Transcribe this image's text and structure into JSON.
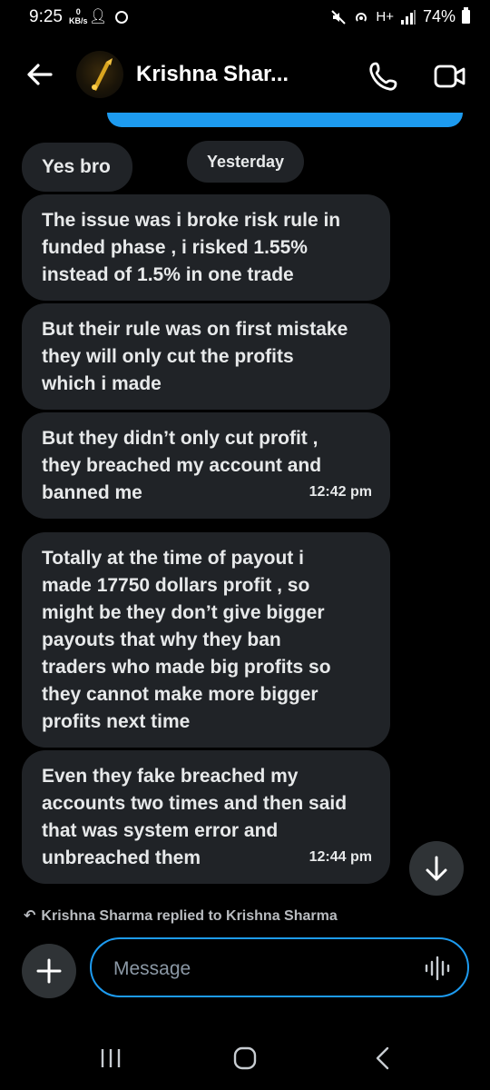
{
  "status_bar": {
    "time": "9:25",
    "net_speed_value": "0",
    "net_speed_unit": "KB/s",
    "battery": "74%",
    "signal_tag": "H+"
  },
  "header": {
    "contact_name": "Krishna Shar...",
    "icons": [
      "back-arrow-icon",
      "avatar",
      "phone-icon",
      "video-camera-icon"
    ]
  },
  "date_divider": "Yesterday",
  "messages": [
    {
      "text": "Yes bro",
      "time": ""
    },
    {
      "text": "The issue was i broke risk rule in\nfunded phase , i risked 1.55%\ninstead of 1.5% in one trade",
      "time": ""
    },
    {
      "text": "But their rule was on first mistake\nthey will only cut the profits\nwhich i made",
      "time": ""
    },
    {
      "text": "But they didn’t only cut profit ,\nthey breached my account and\nbanned me",
      "time": "12:42 pm"
    },
    {
      "text": "Totally at the time of payout i\nmade 17750 dollars profit , so\nmight be they don’t give bigger\npayouts that why they ban\ntraders who made big profits so\nthey cannot make more bigger\nprofits next time",
      "time": ""
    },
    {
      "text": "Even they fake breached my\naccounts two times and then said\nthat was system error and\nunbreached them",
      "time": "12:44 pm"
    }
  ],
  "reply_context": "Krishna Sharma replied to Krishna Sharma",
  "composer": {
    "placeholder": "Message"
  },
  "colors": {
    "accent": "#1d9bf0",
    "bubble": "#202327",
    "background": "#000000"
  }
}
